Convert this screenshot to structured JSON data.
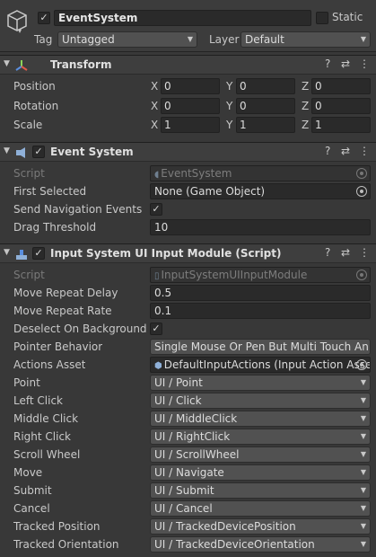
{
  "gameobject": {
    "active_checked": true,
    "name": "EventSystem",
    "static_label": "Static",
    "static_caret": "▾",
    "tag_label": "Tag",
    "tag_value": "Untagged",
    "layer_label": "Layer",
    "layer_value": "Default",
    "icon": "gameobject-cube-icon"
  },
  "transform": {
    "title": "Transform",
    "rows": [
      {
        "label": "Position",
        "x": "0",
        "y": "0",
        "z": "0"
      },
      {
        "label": "Rotation",
        "x": "0",
        "y": "0",
        "z": "0"
      },
      {
        "label": "Scale",
        "x": "1",
        "y": "1",
        "z": "1"
      }
    ],
    "axis_x": "X",
    "axis_y": "Y",
    "axis_z": "Z"
  },
  "event_system": {
    "title": "Event System",
    "enabled": true,
    "script_label": "Script",
    "script_value": "EventSystem",
    "first_selected_label": "First Selected",
    "first_selected_value": "None (Game Object)",
    "send_nav_label": "Send Navigation Events",
    "send_nav_checked": true,
    "drag_threshold_label": "Drag Threshold",
    "drag_threshold_value": "10"
  },
  "input_module": {
    "title": "Input System UI Input Module (Script)",
    "enabled": true,
    "script_label": "Script",
    "script_value": "InputSystemUIInputModule",
    "move_repeat_delay_label": "Move Repeat Delay",
    "move_repeat_delay_value": "0.5",
    "move_repeat_rate_label": "Move Repeat Rate",
    "move_repeat_rate_value": "0.1",
    "deselect_label": "Deselect On Background C",
    "deselect_checked": true,
    "pointer_behavior_label": "Pointer Behavior",
    "pointer_behavior_value": "Single Mouse Or Pen But Multi Touch An",
    "actions_asset_label": "Actions Asset",
    "actions_asset_value": "DefaultInputActions (Input Action Asse",
    "actions": [
      {
        "label": "Point",
        "value": "UI / Point"
      },
      {
        "label": "Left Click",
        "value": "UI / Click"
      },
      {
        "label": "Middle Click",
        "value": "UI / MiddleClick"
      },
      {
        "label": "Right Click",
        "value": "UI / RightClick"
      },
      {
        "label": "Scroll Wheel",
        "value": "UI / ScrollWheel"
      },
      {
        "label": "Move",
        "value": "UI / Navigate"
      },
      {
        "label": "Submit",
        "value": "UI / Submit"
      },
      {
        "label": "Cancel",
        "value": "UI / Cancel"
      },
      {
        "label": "Tracked Position",
        "value": "UI / TrackedDevicePosition"
      },
      {
        "label": "Tracked Orientation",
        "value": "UI / TrackedDeviceOrientation"
      }
    ]
  },
  "header_icons": {
    "help": "?",
    "presets": "⇄",
    "menu": "⋮",
    "fold": "▼",
    "check": "✓",
    "caret": "▼"
  }
}
